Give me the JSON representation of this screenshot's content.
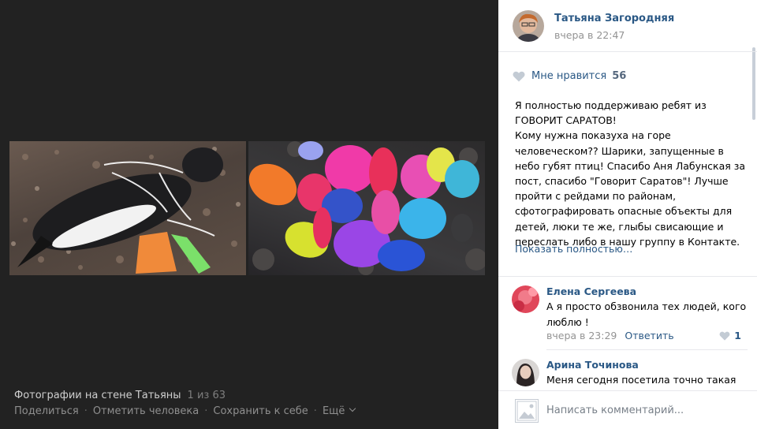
{
  "viewer": {
    "caption": "Фотографии на стене Татьяны",
    "count": "1 из 63",
    "actions": {
      "share": "Поделиться",
      "tag": "Отметить человека",
      "save": "Сохранить к себе",
      "more": "Ещё"
    },
    "separator": "·"
  },
  "post": {
    "author": "Татьяна Загородняя",
    "time": "вчера в 22:47",
    "likes_label": "Мне нравится",
    "likes_count": "56",
    "text_lines": [
      "Я полностью поддерживаю ребят из",
      "ГОВОРИТ САРАТОВ!",
      "Кому нужна показуха на горе",
      "человеческом?? Шарики, запущенные в",
      "небо губят птиц! Спасибо Аня Лабунская за",
      "пост, спасибо \"Говорит Саратов\"! Лучше",
      "пройти с рейдами по районам,",
      "сфотографировать опасные объекты для",
      "детей, люки те же, глыбы свисающие и",
      "переслать либо в нашу группу в Контакте."
    ],
    "show_more": "Показать полностью…"
  },
  "comments": [
    {
      "name": "Елена Сергеева",
      "text_lines": [
        "А я просто обзвонила тех людей, кого",
        "люблю !"
      ],
      "time": "вчера в 23:29",
      "reply": "Ответить",
      "likes": "1"
    },
    {
      "name": "Арина Точинова",
      "text_lines": [
        "Меня сегодня посетила точно такая"
      ]
    }
  ],
  "compose": {
    "placeholder": "Написать комментарий..."
  },
  "colors": {
    "link": "#2a5885",
    "viewer_bg": "#222222",
    "muted": "#939393"
  },
  "icons": {
    "like": "heart-icon",
    "more": "chevron-down-icon"
  }
}
